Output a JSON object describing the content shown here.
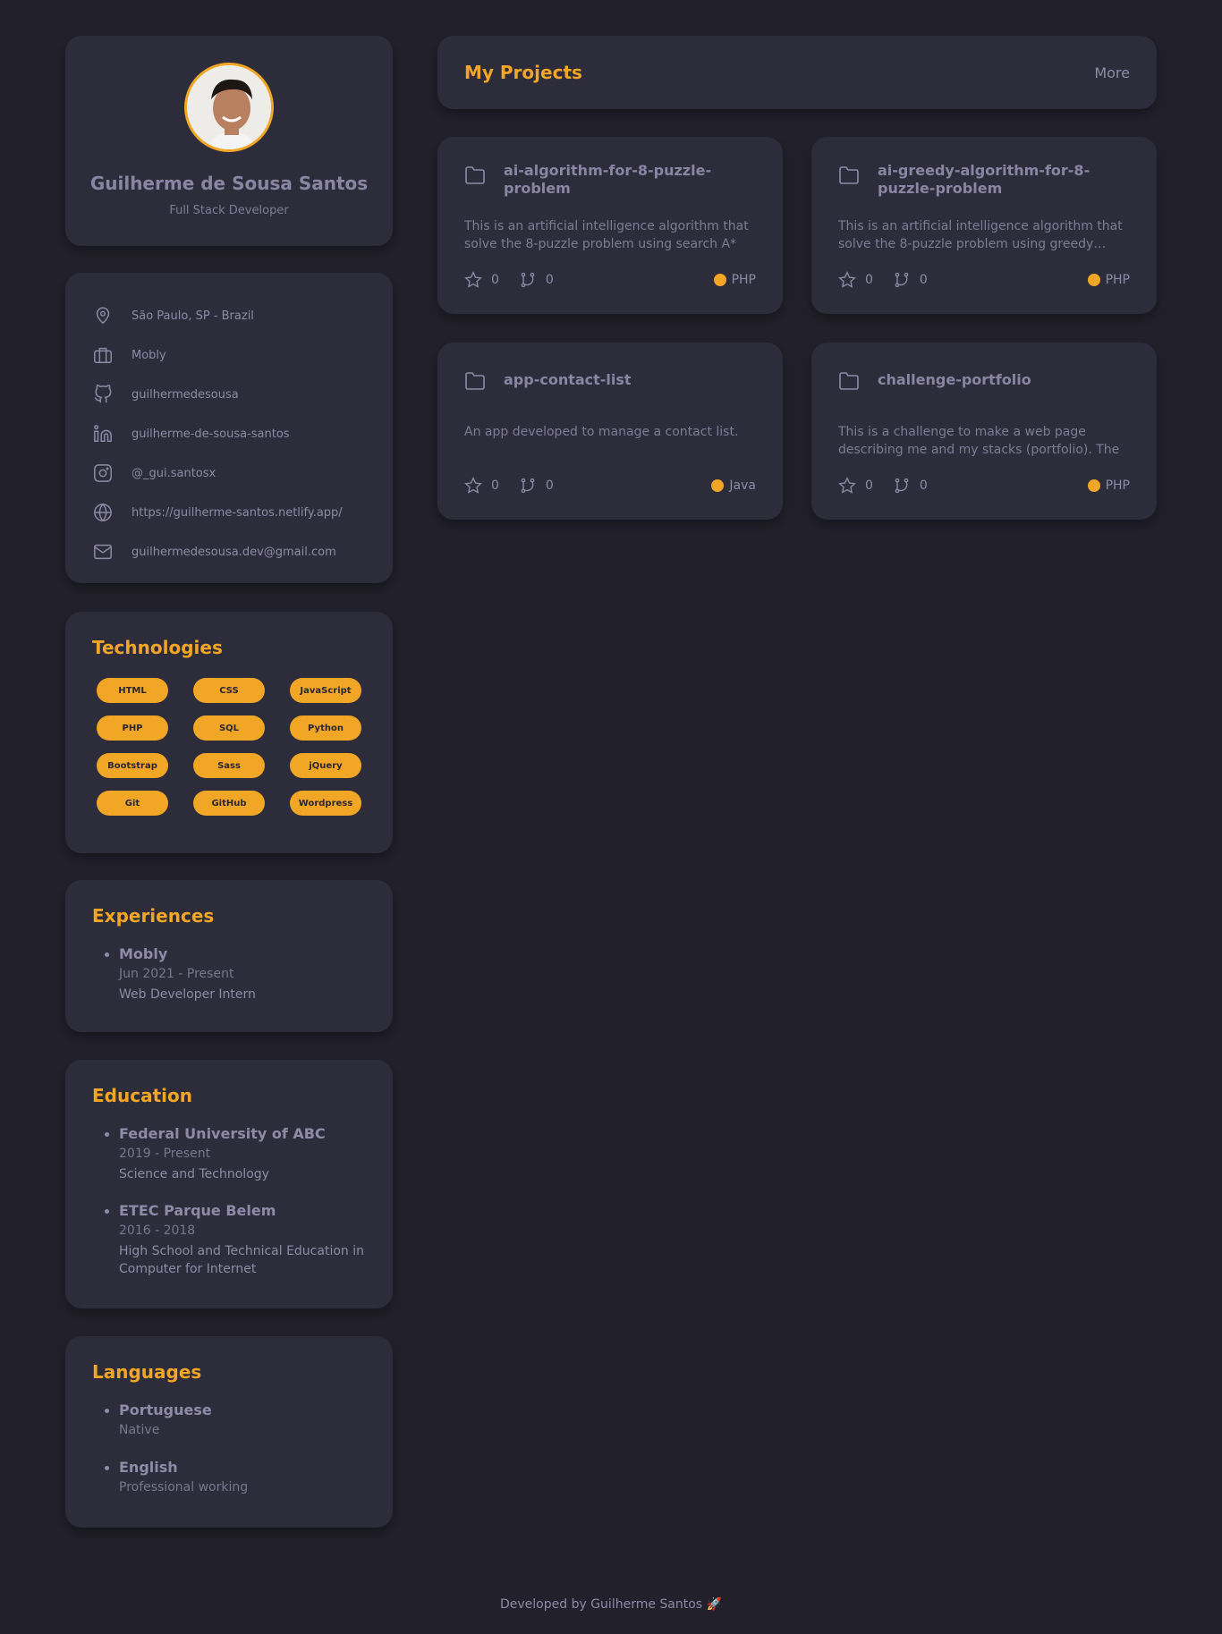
{
  "colors": {
    "accent": "#f2a626",
    "background": "#21202b",
    "card": "#2d2c3a",
    "text": "#8f8aa7"
  },
  "profile": {
    "name": "Guilherme de Sousa Santos",
    "role": "Full Stack Developer"
  },
  "info": {
    "location": "São Paulo, SP - Brazil",
    "company": "Mobly",
    "github": "guilhermedesousa",
    "linkedin": "guilherme-de-sousa-santos",
    "instagram": "@_gui.santosx",
    "website": "https://guilherme-santos.netlify.app/",
    "email": "guilhermedesousa.dev@gmail.com"
  },
  "technologies": {
    "title": "Technologies",
    "items": [
      "HTML",
      "CSS",
      "JavaScript",
      "PHP",
      "SQL",
      "Python",
      "Bootstrap",
      "Sass",
      "jQuery",
      "Git",
      "GitHub",
      "Wordpress"
    ]
  },
  "experiences": {
    "title": "Experiences",
    "items": [
      {
        "name": "Mobly",
        "period": "Jun 2021 - Present",
        "role": "Web Developer Intern"
      }
    ]
  },
  "education": {
    "title": "Education",
    "items": [
      {
        "name": "Federal University of ABC",
        "period": "2019 - Present",
        "course": "Science and Technology"
      },
      {
        "name": "ETEC Parque Belem",
        "period": "2016 - 2018",
        "course": "High School and Technical Education in Computer for Internet"
      }
    ]
  },
  "languages": {
    "title": "Languages",
    "items": [
      {
        "name": "Portuguese",
        "level": "Native"
      },
      {
        "name": "English",
        "level": "Professional working"
      }
    ]
  },
  "projects": {
    "title": "My Projects",
    "more": "More",
    "items": [
      {
        "name": "ai-algorithm-for-8-puzzle-problem",
        "description": "This is an artificial intelligence algorithm that solve the 8-puzzle problem using search A*",
        "stars": "0",
        "forks": "0",
        "language": "PHP"
      },
      {
        "name": "ai-greedy-algorithm-for-8-puzzle-problem",
        "description": "This is an artificial intelligence algorithm that solve the 8-puzzle problem using greedy…",
        "stars": "0",
        "forks": "0",
        "language": "PHP"
      },
      {
        "name": "app-contact-list",
        "description": "An app developed to manage a contact list.",
        "stars": "0",
        "forks": "0",
        "language": "Java"
      },
      {
        "name": "challenge-portfolio",
        "description": "This is a challenge to make a web page describing me and my stacks (portfolio). The purpose is to…",
        "stars": "0",
        "forks": "0",
        "language": "PHP"
      }
    ]
  },
  "footer": {
    "text": "Developed by Guilherme Santos 🚀"
  }
}
